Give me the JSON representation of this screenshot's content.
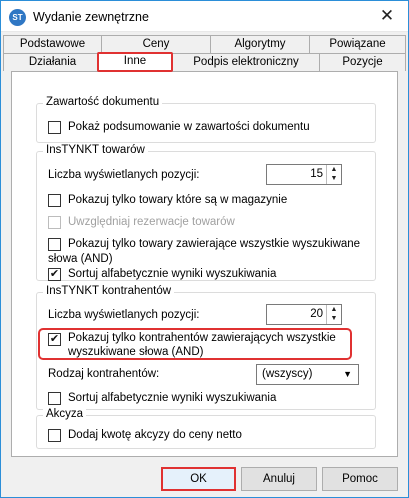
{
  "window": {
    "title": "Wydanie zewnętrzne",
    "icon": "app-logo-icon",
    "close_glyph": "✕"
  },
  "tabs_row1": [
    "Podstawowe",
    "Ceny",
    "Algorytmy",
    "Powiązane"
  ],
  "tabs_row2": [
    "Działania",
    "Inne",
    "Podpis elektroniczny",
    "Pozycje"
  ],
  "active_tab": "Inne",
  "doc_group": {
    "title": "Zawartość dokumentu",
    "show_summary": {
      "label": "Pokaż podsumowanie w zawartości dokumentu",
      "checked": false
    }
  },
  "goods_group": {
    "title": "InsTYNKT towarów",
    "count_label": "Liczba wyświetlanych pozycji:",
    "count_value": "15",
    "only_in_stock": {
      "label": "Pokazuj tylko towary które są w magazynie",
      "checked": false
    },
    "reservations": {
      "label": "Uwzględniaj rezerwacje towarów",
      "checked": false,
      "disabled": true
    },
    "all_words_line1": "Pokazuj tylko towary zawierające wszystkie wyszukiwane",
    "all_words_line2": "słowa (AND)",
    "sort_alpha": {
      "label": "Sortuj alfabetycznie wyniki wyszukiwania",
      "checked": true
    }
  },
  "contractors_group": {
    "title": "InsTYNKT kontrahentów",
    "count_label": "Liczba wyświetlanych pozycji:",
    "count_value": "20",
    "all_words_line1": "Pokazuj tylko kontrahentów zawierających wszystkie",
    "all_words_line2": "wyszukiwane słowa (AND)",
    "all_words_checked": true,
    "kind_label": "Rodzaj kontrahentów:",
    "kind_value": "(wszyscy)",
    "sort_alpha": {
      "label": "Sortuj alfabetycznie wyniki wyszukiwania",
      "checked": false
    }
  },
  "excise_group": {
    "title": "Akcyza",
    "add_excise": {
      "label": "Dodaj kwotę akcyzy do ceny netto",
      "checked": false
    }
  },
  "buttons": {
    "ok": "OK",
    "cancel": "Anuluj",
    "help": "Pomoc"
  }
}
